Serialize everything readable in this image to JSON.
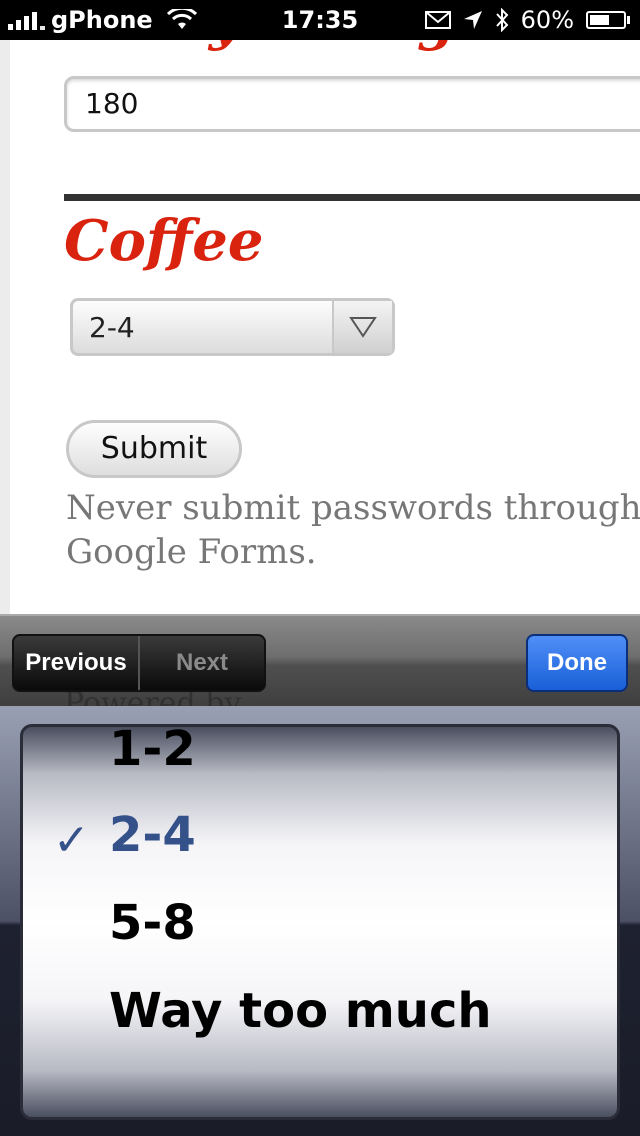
{
  "status_bar": {
    "carrier": "gPhone",
    "time": "17:35",
    "battery": "60%",
    "battery_level": 0.6
  },
  "form": {
    "weight_heading": "Today's Weight",
    "weight_value": "180",
    "coffee_heading": "Coffee",
    "coffee_selected": "2-4",
    "submit_label": "Submit",
    "note": "Never submit passwords through Google Forms.",
    "powered_by": "Powered by"
  },
  "toolbar": {
    "previous_label": "Previous",
    "next_label": "Next",
    "done_label": "Done"
  },
  "picker": {
    "options": [
      "1-2",
      "2-4",
      "5-8",
      "Way too much"
    ],
    "selected": "2-4"
  },
  "colors": {
    "heading_red": "#d9230f",
    "done_blue": "#1a5fd8",
    "selected_option": "#34518a"
  },
  "icons": [
    "signal-icon",
    "wifi-icon",
    "mail-icon",
    "location-icon",
    "bluetooth-icon",
    "battery-icon",
    "dropdown-arrow-icon",
    "checkmark-icon"
  ]
}
